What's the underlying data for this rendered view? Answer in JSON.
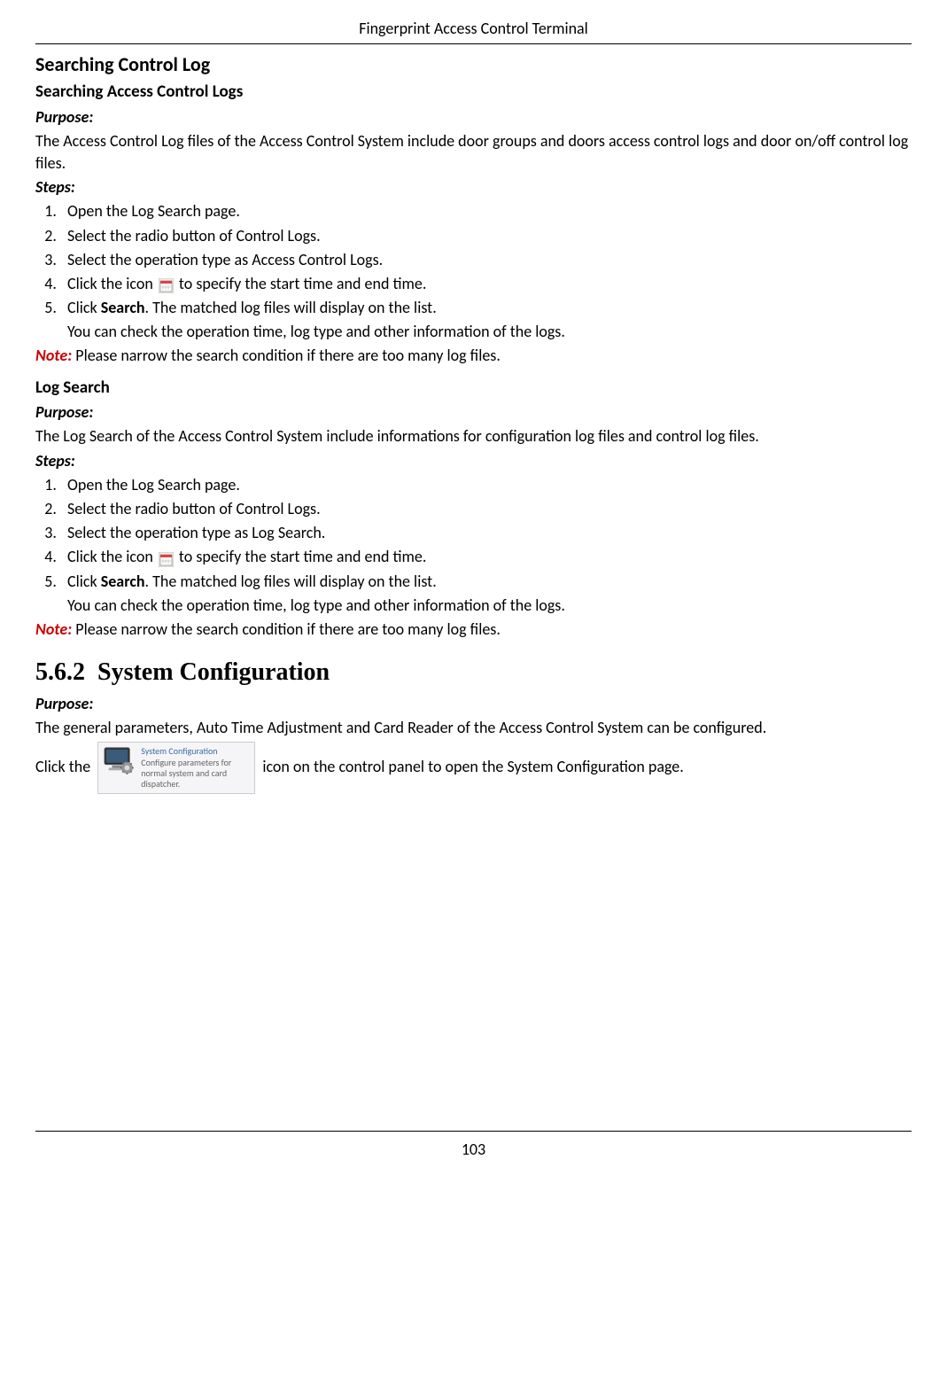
{
  "header": {
    "title": "Fingerprint Access Control Terminal"
  },
  "section1": {
    "heading": "Searching Control Log",
    "sub1": {
      "title": "Searching Access Control Logs",
      "purpose_label": "Purpose:",
      "purpose_text": "The Access Control Log files of the Access Control System include door groups and doors access control logs and door on/off control log files.",
      "steps_label": "Steps:",
      "steps": [
        "Open the Log Search page.",
        "Select the radio button of Control Logs.",
        "Select the operation type as Access Control Logs."
      ],
      "step4_prefix": "Click the icon",
      "step4_suffix": " to specify the start time and end time.",
      "step5_prefix": "Click ",
      "step5_bold": "Search",
      "step5_suffix": ". The matched log files will display on the list.",
      "step5_note": "You can check the operation time, log type and other information of the logs.",
      "note_label": "Note:",
      "note_text": " Please narrow the search condition if there are too many log files."
    },
    "sub2": {
      "title": "Log Search",
      "purpose_label": "Purpose:",
      "purpose_text": "The Log Search of the Access Control System include informations for configuration log files and control log files.",
      "steps_label": "Steps:",
      "steps": [
        "Open the Log Search page.",
        "Select the radio button of Control Logs.",
        "Select the operation type as Log Search."
      ],
      "step4_prefix": "Click the icon",
      "step4_suffix": " to specify the start time and end time.",
      "step5_prefix": "Click ",
      "step5_bold": "Search",
      "step5_suffix": ". The matched log files will display on the list.",
      "step5_note": "You can check the operation time, log type and other information of the logs.",
      "note_label": "Note:",
      "note_text": " Please narrow the search condition if there are too many log files."
    }
  },
  "section2": {
    "number": "5.6.2",
    "title": "System Configuration",
    "purpose_label": "Purpose:",
    "purpose_text": "The general parameters, Auto Time Adjustment and Card Reader of the Access Control System can be configured.",
    "click_prefix": "Click the ",
    "click_suffix": " icon on the control panel to open the System Configuration page.",
    "icon_title": "System Configuration",
    "icon_desc": "Configure parameters for normal system and card dispatcher."
  },
  "footer": {
    "page_number": "103"
  }
}
